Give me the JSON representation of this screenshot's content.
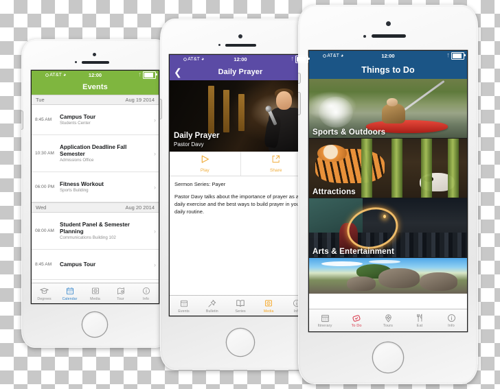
{
  "scene": {
    "description": "Three white iPhone 5s devices shown side by side on a transparent checkerboard background, each displaying a different mobile app screen",
    "background": "transparent-checkerboard"
  },
  "colors": {
    "events_green": "#7FB63F",
    "prayer_purple": "#5B4BA5",
    "todo_blue": "#1B5586",
    "tab_active_blue": "#2F82C9",
    "tab_active_orange": "#F5A623",
    "tab_active_red": "#D9384A",
    "action_orange": "#F0AD3C"
  },
  "phone_left": {
    "status_bar": {
      "signal_dots": 5,
      "signal_filled": 4,
      "carrier": "AT&T",
      "wifi_icon": "wifi-icon",
      "time": "12:00",
      "bluetooth_icon": "bluetooth-icon",
      "battery_icon": "battery-icon"
    },
    "nav_title": "Events",
    "sections": [
      {
        "day": "Tue",
        "date": "Aug 19 2014",
        "events": [
          {
            "time": "8:45 AM",
            "title": "Campus Tour",
            "location": "Students Center",
            "chevron": "chevron-right-icon"
          },
          {
            "time": "10:30 AM",
            "title": "Application Deadline Fall Semester",
            "location": "Admissions Office",
            "chevron": "chevron-right-icon"
          },
          {
            "time": "06:00 PM",
            "title": "Fitness Workout",
            "location": "Sports Building",
            "chevron": "chevron-right-icon"
          }
        ]
      },
      {
        "day": "Wed",
        "date": "Aug 20 2014",
        "events": [
          {
            "time": "08:00 AM",
            "title": "Student Panel & Semester Planning",
            "location": "Communications Building 102",
            "chevron": "chevron-right-icon"
          },
          {
            "time": "8:45 AM",
            "title": "Campus Tour",
            "location": "",
            "chevron": "chevron-right-icon"
          }
        ]
      }
    ],
    "tabs": [
      {
        "label": "Degrees",
        "icon": "graduation-cap-icon",
        "active": false
      },
      {
        "label": "Calendar",
        "icon": "calendar-icon",
        "active": true
      },
      {
        "label": "Media",
        "icon": "media-play-icon",
        "active": false
      },
      {
        "label": "Tour",
        "icon": "map-pin-icon",
        "active": false
      },
      {
        "label": "Info",
        "icon": "info-circle-icon",
        "active": false
      }
    ]
  },
  "phone_center": {
    "status_bar": {
      "signal_dots": 5,
      "signal_filled": 4,
      "carrier": "AT&T",
      "wifi_icon": "wifi-icon",
      "time": "12:00",
      "bluetooth_icon": "bluetooth-icon",
      "battery_icon": "battery-icon"
    },
    "back_icon": "chevron-left-icon",
    "nav_title": "Daily Prayer",
    "hero": {
      "title": "Daily Prayer",
      "subtitle": "Pastor Davy",
      "image_alt": "man speaking into a handheld microphone on a dark stage"
    },
    "actions": [
      {
        "label": "Play",
        "icon": "play-triangle-icon"
      },
      {
        "label": "Share",
        "icon": "share-arrow-icon"
      }
    ],
    "series_line": "Sermon Series: Payer",
    "description": "Pastor Davy talks about the importance of prayer as a daily exercise and the best ways to build prayer in your daily routine.",
    "tabs": [
      {
        "label": "Events",
        "icon": "calendar-icon",
        "active": false
      },
      {
        "label": "Bulletin",
        "icon": "pushpin-icon",
        "active": false
      },
      {
        "label": "Series",
        "icon": "open-book-icon",
        "active": false
      },
      {
        "label": "Media",
        "icon": "media-play-icon",
        "active": true
      },
      {
        "label": "Info",
        "icon": "info-circle-icon",
        "active": false
      }
    ]
  },
  "phone_right": {
    "status_bar": {
      "signal_dots": 5,
      "signal_filled": 4,
      "carrier": "AT&T",
      "wifi_icon": "wifi-icon",
      "time": "12:00",
      "bluetooth_icon": "bluetooth-icon",
      "battery_icon": "battery-icon"
    },
    "nav_title": "Things to Do",
    "cards": [
      {
        "label": "Sports & Outdoors",
        "image_alt": "kayaker paddling through whitewater rapids"
      },
      {
        "label": "Attractions",
        "image_alt": "tiger and panda among bamboo stalks at a zoo"
      },
      {
        "label": "Arts & Entertainment",
        "image_alt": "fire dancer performing at night in front of a crowd"
      },
      {
        "label": "",
        "image_alt": "tropical beach with granite boulders and palm trees"
      }
    ],
    "tabs": [
      {
        "label": "Itinerary",
        "icon": "calendar-icon",
        "active": false
      },
      {
        "label": "To Do",
        "icon": "checklist-tag-icon",
        "active": true
      },
      {
        "label": "Tours",
        "icon": "compass-pin-icon",
        "active": false
      },
      {
        "label": "Eat",
        "icon": "fork-knife-icon",
        "active": false
      },
      {
        "label": "Info",
        "icon": "info-circle-icon",
        "active": false
      }
    ]
  }
}
